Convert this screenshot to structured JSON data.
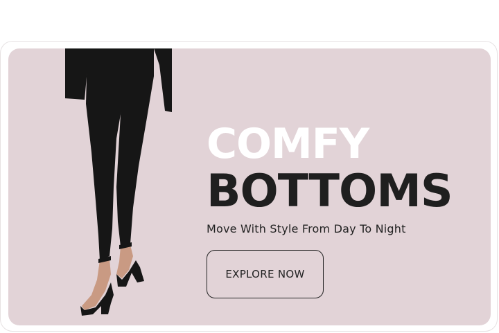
{
  "colors": {
    "banner_background": "#e2d3d7",
    "headline_light": "#ffffff",
    "headline_dark": "#1f1f1f",
    "text_dark": "#222222",
    "garment": "#161616",
    "skin": "#c99a83"
  },
  "banner": {
    "headline_line1": "COMFY",
    "headline_line2": "BOTTOMS",
    "tagline": "Move With Style From Day To Night",
    "cta_label": "EXPLORE NOW",
    "image_icon": "model-in-black-leggings-and-heels"
  }
}
